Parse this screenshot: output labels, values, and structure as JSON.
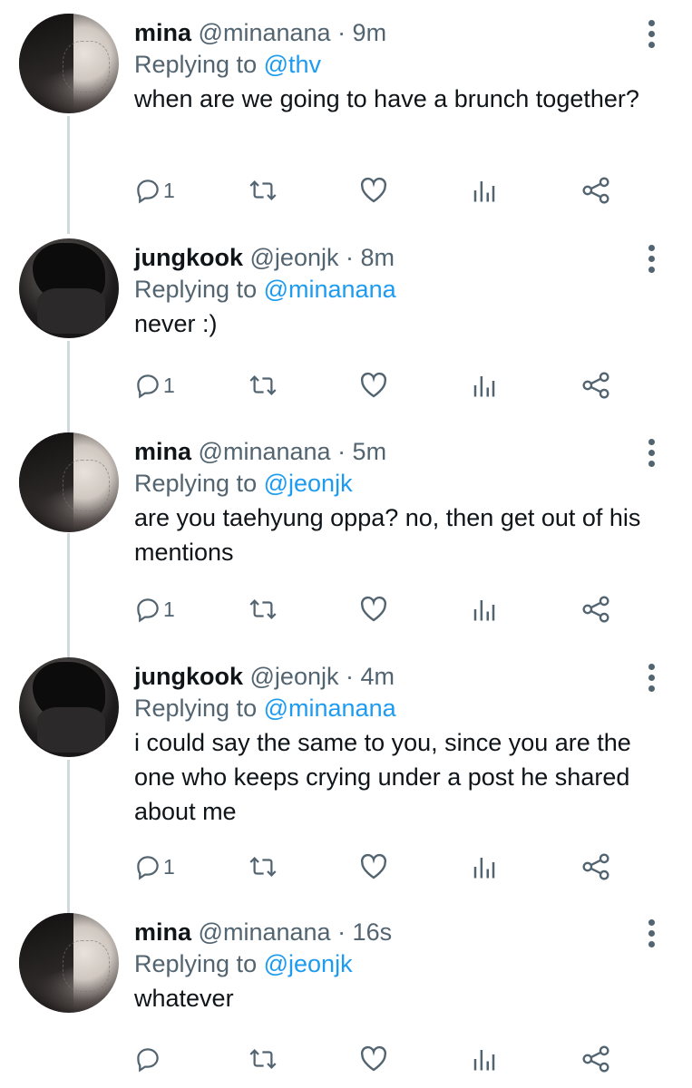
{
  "tweets": [
    {
      "avatar": "mina",
      "name": "mina",
      "handle": "@minanana",
      "time": "· 9m",
      "reply_prefix": "Replying to",
      "reply_to": "@thv",
      "text": "when are we going to have a brunch together?",
      "replies": "1"
    },
    {
      "avatar": "jk",
      "name": "jungkook",
      "handle": "@jeonjk",
      "time": "· 8m",
      "reply_prefix": "Replying to",
      "reply_to": "@minanana",
      "text": "never :)",
      "replies": "1"
    },
    {
      "avatar": "mina",
      "name": "mina",
      "handle": "@minanana",
      "time": "· 5m",
      "reply_prefix": "Replying to",
      "reply_to": "@jeonjk",
      "text": "are you taehyung oppa? no, then get out of his mentions",
      "replies": "1"
    },
    {
      "avatar": "jk",
      "name": "jungkook",
      "handle": "@jeonjk",
      "time": "· 4m",
      "reply_prefix": "Replying to",
      "reply_to": "@minanana",
      "text": "i could say the same to you, since you are the one who keeps crying under a post he shared about me",
      "replies": "1"
    },
    {
      "avatar": "mina",
      "name": "mina",
      "handle": "@minanana",
      "time": "· 16s",
      "reply_prefix": "Replying to",
      "reply_to": "@jeonjk",
      "text": "whatever",
      "replies": ""
    }
  ],
  "icons": {
    "reply": "reply-icon",
    "retweet": "retweet-icon",
    "like": "heart-icon",
    "analytics": "analytics-icon",
    "share": "share-icon",
    "more": "more-icon"
  },
  "colors": {
    "link": "#1d9bf0",
    "secondary": "#536471",
    "thread_line": "#cfd9de"
  }
}
